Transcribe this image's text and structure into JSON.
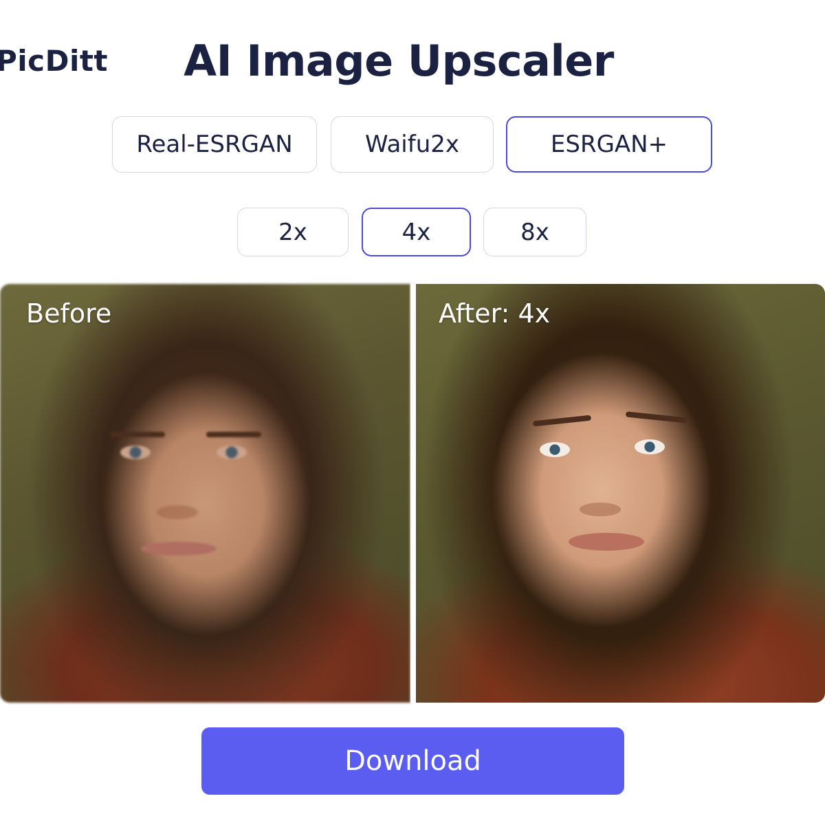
{
  "app": {
    "brand": "PicDitt",
    "title": "AI Image Upscaler"
  },
  "models": {
    "options": [
      "Real-ESRGAN",
      "Waifu2x",
      "ESRGAN+"
    ],
    "selected": "ESRGAN+"
  },
  "scale": {
    "options": [
      "2x",
      "4x",
      "8x"
    ],
    "selected": "4x"
  },
  "preview": {
    "before_label": "Before",
    "after_label": "After: 4x"
  },
  "actions": {
    "download_label": "Download"
  },
  "colors": {
    "accent": "#5b5cf0",
    "selected_border": "#4c49d8",
    "text": "#1b2140",
    "button_border": "#d3d6e6"
  }
}
